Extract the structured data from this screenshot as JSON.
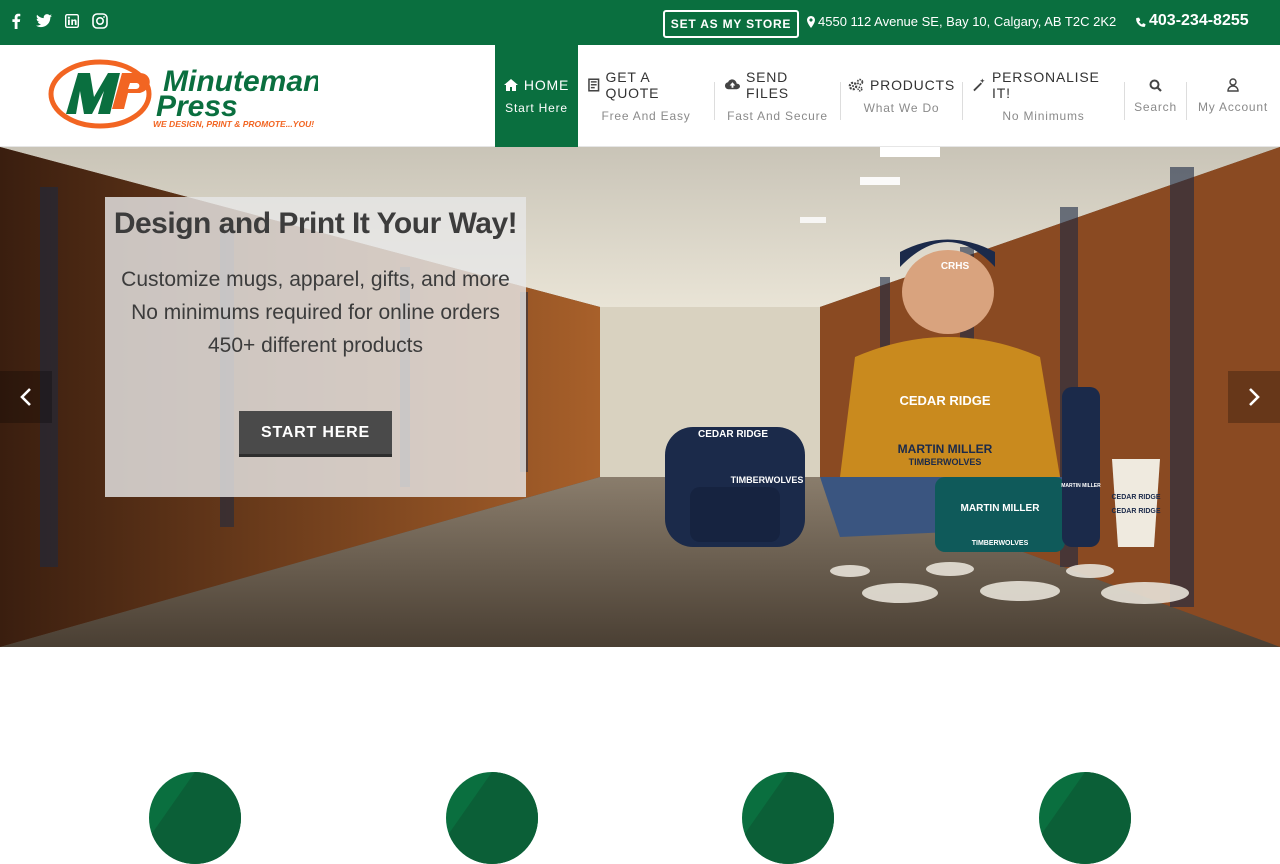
{
  "topbar": {
    "social": [
      {
        "name": "facebook-icon"
      },
      {
        "name": "twitter-icon"
      },
      {
        "name": "linkedin-icon"
      },
      {
        "name": "instagram-icon"
      }
    ],
    "store_button": "SET AS MY STORE",
    "address": "4550 112 Avenue SE, Bay 10, Calgary, AB T2C 2K2",
    "phone": "403-234-8255"
  },
  "logo": {
    "title": "Minuteman",
    "title2": "Press",
    "tagline": "WE DESIGN, PRINT & PROMOTE...YOU!"
  },
  "nav": [
    {
      "label": "HOME",
      "sub": "Start Here",
      "icon": "home-icon"
    },
    {
      "label": "GET A QUOTE",
      "sub": "Free And Easy",
      "icon": "quote-icon"
    },
    {
      "label": "SEND FILES",
      "sub": "Fast And Secure",
      "icon": "cloud-upload-icon"
    },
    {
      "label": "PRODUCTS",
      "sub": "What We Do",
      "icon": "gears-icon"
    },
    {
      "label": "PERSONALISE IT!",
      "sub": "No Minimums",
      "icon": "magic-wand-icon"
    },
    {
      "label": "",
      "sub": "Search",
      "icon": "search-icon"
    },
    {
      "label": "",
      "sub": "My Account",
      "icon": "user-icon"
    }
  ],
  "hero": {
    "title": "Design and Print It Your Way!",
    "line1": "Customize mugs, apparel, gifts, and more",
    "line2": "No minimums required for online orders",
    "line3": "450+ different products",
    "button": "START HERE",
    "image_text": {
      "cap": "CRHS",
      "hoodie1": "CEDAR RIDGE",
      "hoodie2": "MARTIN MILLER",
      "hoodie3": "TIMBERWOLVES",
      "bag1": "CEDAR RIDGE",
      "bag2": "TIMBERWOLVES",
      "pouch1": "MARTIN MILLER",
      "pouch2": "TIMBERWOLVES",
      "bottle": "MARTIN MILLER",
      "cup1": "CEDAR RIDGE",
      "cup2": "CEDAR RIDGE"
    }
  },
  "colors": {
    "brand_green": "#0a6f3f",
    "brand_orange": "#f26522"
  }
}
